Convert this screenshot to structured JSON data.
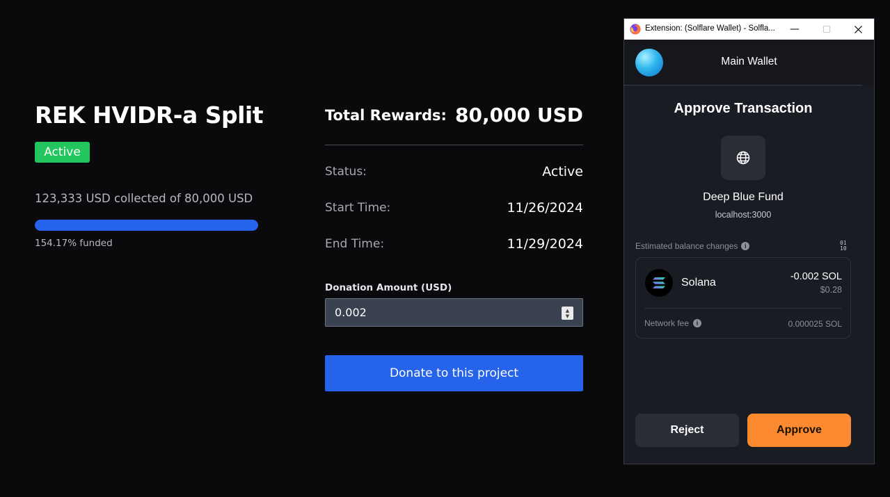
{
  "project": {
    "title": "REK HVIDR-a Split",
    "status_badge": "Active",
    "collected_text": "123,333 USD collected of 80,000 USD",
    "funded_text": "154.17% funded",
    "progress_fraction": 1.0,
    "accent_color": "#2563eb",
    "badge_color": "#22c55e"
  },
  "details": {
    "total_rewards_label": "Total Rewards:",
    "total_rewards_value": "80,000 USD",
    "status_label": "Status:",
    "status_value": "Active",
    "start_label": "Start Time:",
    "start_value": "11/26/2024",
    "end_label": "End Time:",
    "end_value": "11/29/2024",
    "donation_label": "Donation Amount (USD)",
    "donation_value": "0.002",
    "donate_button": "Donate to this project"
  },
  "wallet": {
    "window_title": "Extension: (Solflare Wallet) - Solfla...",
    "window_icon": "firefox-icon",
    "wallet_name": "Main Wallet",
    "heading": "Approve Transaction",
    "site_icon": "globe-icon",
    "site_name": "Deep Blue Fund",
    "site_url": "localhost:3000",
    "balance_changes_label": "Estimated balance changes",
    "binary_toggle_top": "01",
    "binary_toggle_bottom": "10",
    "token_name": "Solana",
    "token_amount": "-0.002 SOL",
    "token_usd": "$0.28",
    "network_fee_label": "Network fee",
    "network_fee_value": "0.000025 SOL",
    "reject_button": "Reject",
    "approve_button": "Approve",
    "approve_color": "#fc8a30"
  }
}
